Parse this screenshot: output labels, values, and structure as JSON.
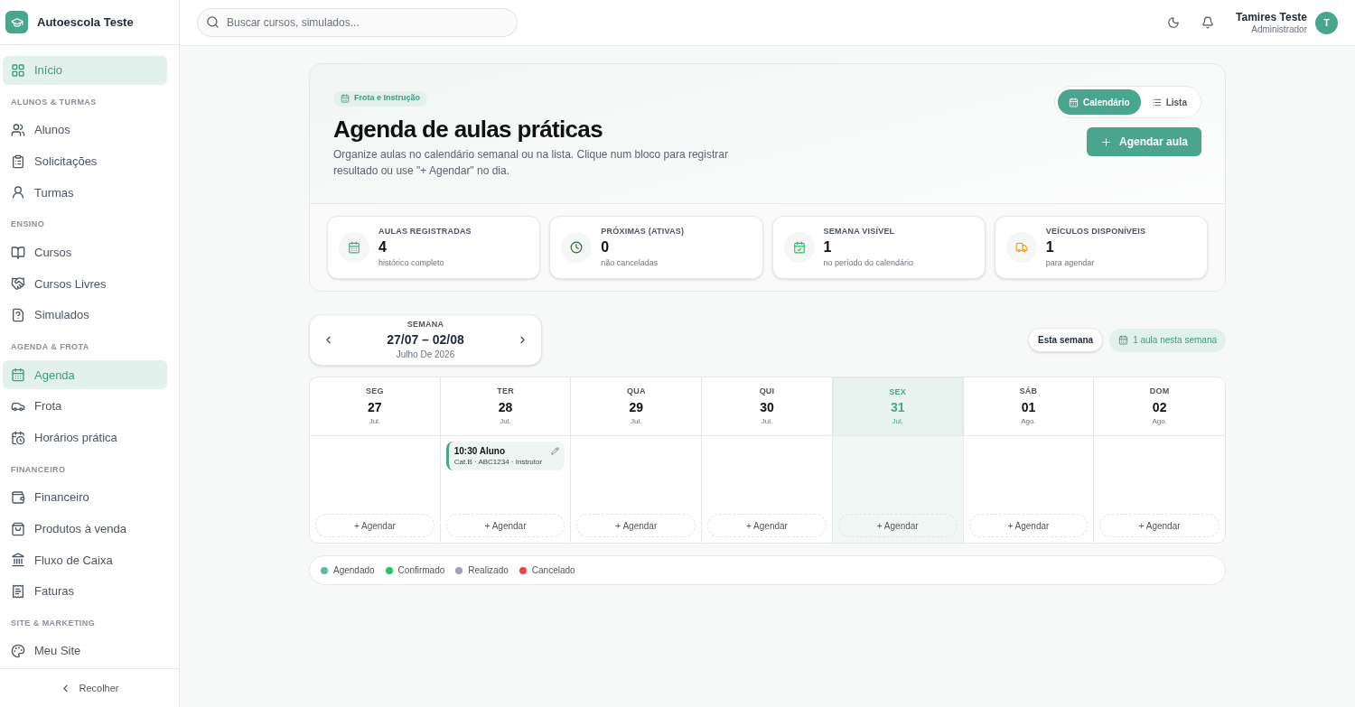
{
  "brand": {
    "name": "Autoescola Teste"
  },
  "sidebar": {
    "items": [
      {
        "kind": "item",
        "label": "Início",
        "selected": true
      },
      {
        "kind": "section",
        "label": "ALUNOS & TURMAS"
      },
      {
        "kind": "item",
        "label": "Alunos",
        "selected": false
      },
      {
        "kind": "item",
        "label": "Solicitações",
        "selected": false
      },
      {
        "kind": "item",
        "label": "Turmas",
        "selected": false
      },
      {
        "kind": "section",
        "label": "ENSINO"
      },
      {
        "kind": "item",
        "label": "Cursos",
        "selected": false
      },
      {
        "kind": "item",
        "label": "Cursos Livres",
        "selected": false
      },
      {
        "kind": "item",
        "label": "Simulados",
        "selected": false
      },
      {
        "kind": "section",
        "label": "AGENDA & FROTA"
      },
      {
        "kind": "item",
        "label": "Agenda",
        "selected": true
      },
      {
        "kind": "item",
        "label": "Frota",
        "selected": false
      },
      {
        "kind": "item",
        "label": "Horários prática",
        "selected": false
      },
      {
        "kind": "section",
        "label": "FINANCEIRO"
      },
      {
        "kind": "item",
        "label": "Financeiro",
        "selected": false
      },
      {
        "kind": "item",
        "label": "Produtos à venda",
        "selected": false
      },
      {
        "kind": "item",
        "label": "Fluxo de Caixa",
        "selected": false
      },
      {
        "kind": "item",
        "label": "Faturas",
        "selected": false
      },
      {
        "kind": "section",
        "label": "SITE & MARKETING"
      },
      {
        "kind": "item",
        "label": "Meu Site",
        "selected": false
      }
    ],
    "collapse": "Recolher"
  },
  "topbar": {
    "search": {
      "placeholder": "Buscar cursos, simulados..."
    },
    "user": {
      "name": "Tamires Teste",
      "role": "Administrador",
      "initial": "T"
    }
  },
  "header": {
    "badge": "Frota e Instrução",
    "title": "Agenda de aulas práticas",
    "description": "Organize aulas no calendário semanal ou na lista. Clique num bloco para registrar resultado ou use \"+ Agendar\" no dia.",
    "views": [
      {
        "label": "Calendário",
        "selected": true
      },
      {
        "label": "Lista",
        "selected": false
      }
    ],
    "action": "Agendar aula"
  },
  "stats": [
    {
      "label": "AULAS REGISTRADAS",
      "value": "4",
      "note": "histórico completo"
    },
    {
      "label": "PRÓXIMAS (ATIVAS)",
      "value": "0",
      "note": "não canceladas"
    },
    {
      "label": "SEMANA VISÍVEL",
      "value": "1",
      "note": "no período do calendário"
    },
    {
      "label": "VEÍCULOS DISPONÍVEIS",
      "value": "1",
      "note": "para agendar"
    }
  ],
  "week": {
    "label": "SEMANA",
    "range": "27/07 – 02/08",
    "month": "Julho De 2026",
    "today_button": "Esta semana",
    "count_badge": "1 aula nesta semana"
  },
  "days": [
    {
      "weekday": "SEG",
      "day": "27",
      "month": "Jul.",
      "selected": false,
      "add": "+ Agendar"
    },
    {
      "weekday": "TER",
      "day": "28",
      "month": "Jul.",
      "selected": false,
      "add": "+ Agendar",
      "events": [
        {
          "title": "10:30 Aluno",
          "detail": "Cat.B · ABC1234 · Instrutor",
          "color": "#4aa58e"
        }
      ]
    },
    {
      "weekday": "QUA",
      "day": "29",
      "month": "Jul.",
      "selected": false,
      "add": "+ Agendar"
    },
    {
      "weekday": "QUI",
      "day": "30",
      "month": "Jul.",
      "selected": false,
      "add": "+ Agendar"
    },
    {
      "weekday": "SEX",
      "day": "31",
      "month": "Jul.",
      "selected": true,
      "add": "+ Agendar"
    },
    {
      "weekday": "SÁB",
      "day": "01",
      "month": "Ago.",
      "selected": false,
      "add": "+ Agendar"
    },
    {
      "weekday": "DOM",
      "day": "02",
      "month": "Ago.",
      "selected": false,
      "add": "+ Agendar"
    }
  ],
  "legend": [
    {
      "label": "Agendado",
      "color": "#5fb8a0"
    },
    {
      "label": "Confirmado",
      "color": "#22c55e"
    },
    {
      "label": "Realizado",
      "color": "#9ca3af"
    },
    {
      "label": "Cancelado",
      "color": "#ef4444"
    }
  ]
}
